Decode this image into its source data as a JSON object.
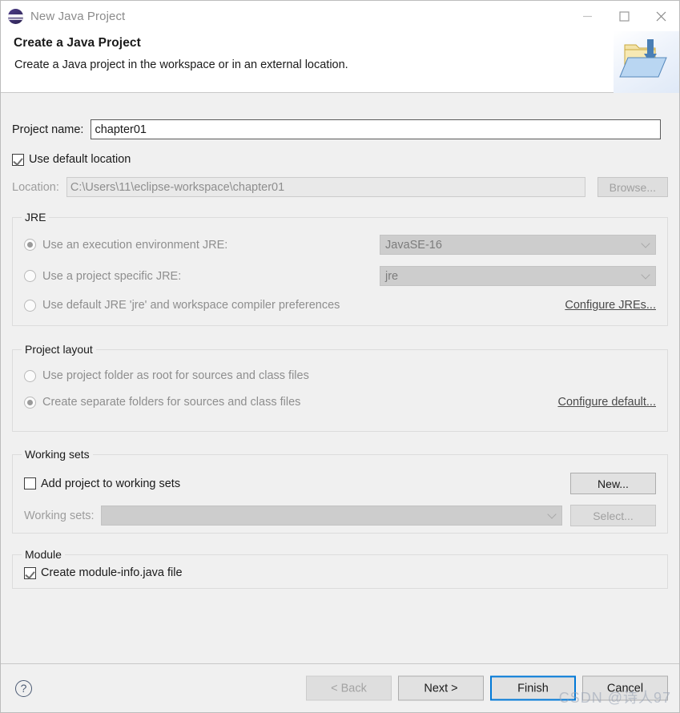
{
  "window": {
    "title": "New Java Project",
    "icon": "eclipse-icon",
    "minimize_label": "—",
    "maximize_label": "□",
    "close_label": "✕"
  },
  "banner": {
    "title": "Create a Java Project",
    "description": "Create a Java project in the workspace or in an external location.",
    "icon": "folder-with-arrow-icon"
  },
  "project_name": {
    "label": "Project name:",
    "value": "chapter01",
    "placeholder": ""
  },
  "location": {
    "use_default_label": "Use default location",
    "use_default_checked": true,
    "label": "Location:",
    "value": "C:\\Users\\11\\eclipse-workspace\\chapter01",
    "browse_label": "Browse..."
  },
  "jre": {
    "group_title": "JRE",
    "options": [
      {
        "label": "Use an execution environment JRE:",
        "selected": true
      },
      {
        "label": "Use a project specific JRE:",
        "selected": false
      },
      {
        "label": "Use default JRE 'jre' and workspace compiler preferences",
        "selected": false
      }
    ],
    "execution_environment_value": "JavaSE-16",
    "project_jre_value": "jre",
    "configure_link": "Configure JREs..."
  },
  "project_layout": {
    "group_title": "Project layout",
    "options": [
      {
        "label": "Use project folder as root for sources and class files",
        "selected": false
      },
      {
        "label": "Create separate folders for sources and class files",
        "selected": true
      }
    ],
    "configure_link": "Configure default..."
  },
  "working_sets": {
    "group_title": "Working sets",
    "add_label": "Add project to working sets",
    "add_checked": false,
    "new_label": "New...",
    "label": "Working sets:",
    "value": "",
    "select_label": "Select..."
  },
  "module": {
    "group_title": "Module",
    "create_label": "Create module-info.java file",
    "create_checked": true
  },
  "footer": {
    "help_label": "?",
    "back_label": "< Back",
    "next_label": "Next >",
    "finish_label": "Finish",
    "cancel_label": "Cancel"
  },
  "watermark": {
    "text": "CSDN @诗人97"
  },
  "colors": {
    "accent": "#0078d7",
    "dialog_bg": "#f0f0f0",
    "header_bg": "#ffffff",
    "disabled_text": "#8e8e8e",
    "text": "#1a1a1a"
  }
}
